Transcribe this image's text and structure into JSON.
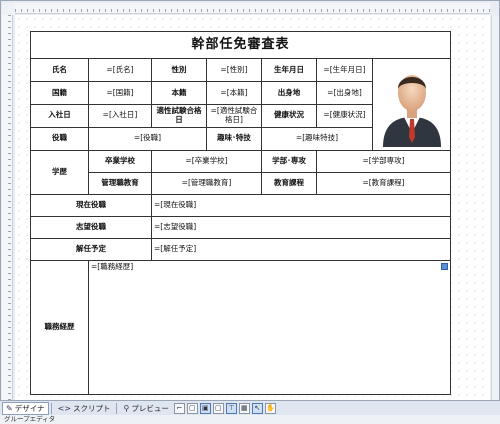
{
  "report": {
    "title": "幹部任免審査表",
    "row1": {
      "name_label": "氏名",
      "name_value": "=[氏名]",
      "gender_label": "性別",
      "gender_value": "=[性別]",
      "birth_label": "生年月日",
      "birth_value": "=[生年月日]"
    },
    "row2": {
      "nationality_label": "国籍",
      "nationality_value": "=[国籍]",
      "domicile_label": "本籍",
      "domicile_value": "=[本籍]",
      "birthplace_label": "出身地",
      "birthplace_value": "=[出身地]"
    },
    "row3": {
      "joined_label": "入社日",
      "joined_value": "=[入社日]",
      "exam_label": "適性試験合格日",
      "exam_value": "=[適性試験合格日]",
      "health_label": "健康状況",
      "health_value": "=[健康状況]"
    },
    "row4": {
      "position_label": "役職",
      "position_value": "=[役職]",
      "hobby_label": "趣味･特技",
      "hobby_value": "=[趣味特技]"
    },
    "education": {
      "label": "学歴",
      "school_label": "卒業学校",
      "school_value": "=[卒業学校]",
      "major_label": "学部･専攻",
      "major_value": "=[学部専攻]",
      "mgmt_label": "管理職教育",
      "mgmt_value": "=[管理職教育]",
      "course_label": "教育課程",
      "course_value": "=[教育課程]"
    },
    "current_label": "現在役職",
    "current_value": "=[現在役職]",
    "desired_label": "志望役職",
    "desired_value": "=[志望役職]",
    "dismiss_label": "解任予定",
    "dismiss_value": "=[解任予定]",
    "career_label": "職務経歴",
    "career_value": "=[職務経歴]"
  },
  "toolbar": {
    "designer_label": "デザイナ",
    "script_label": "スクリプト",
    "preview_label": "プレビュー"
  },
  "statusbar": {
    "text": "グループエディタ"
  },
  "icons": {
    "designer": "pencil-icon",
    "script": "code-icon",
    "preview": "magnifier-icon",
    "photo": "person-avatar"
  }
}
